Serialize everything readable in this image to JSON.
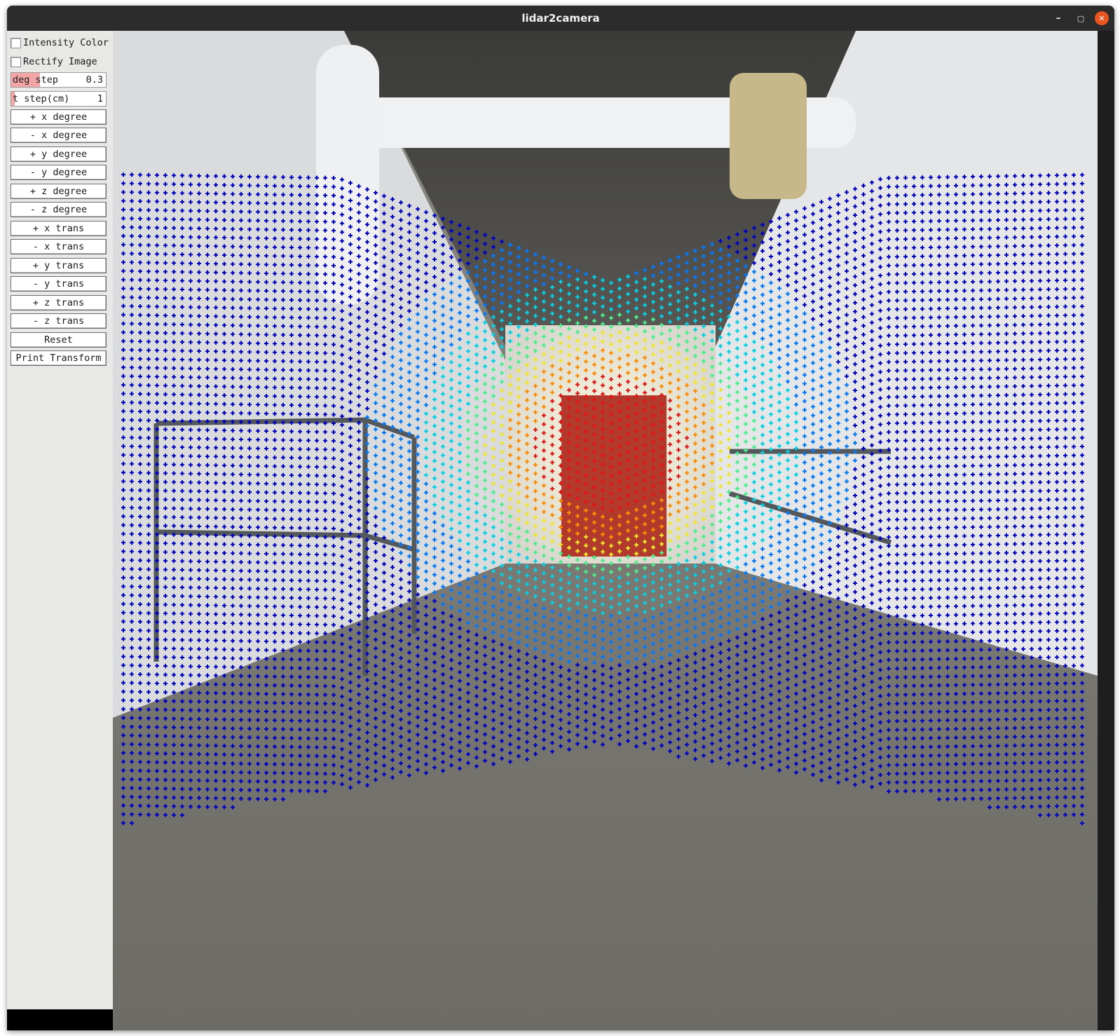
{
  "window": {
    "title": "lidar2camera",
    "minimize_icon": "minimize-icon",
    "maximize_icon": "maximize-icon",
    "close_icon": "close-icon",
    "close_color": "#e95420"
  },
  "controls": {
    "intensity_color": {
      "label": "Intensity Color",
      "checked": false
    },
    "rectify_image": {
      "label": "Rectify Image",
      "checked": false
    },
    "deg_step": {
      "label": "deg step",
      "value": "0.3",
      "slider_fraction": 0.3
    },
    "t_step": {
      "label": "t step(cm)",
      "value": "1",
      "slider_fraction": 0.04
    },
    "buttons": [
      "+ x degree",
      "- x degree",
      "+ y degree",
      "- y degree",
      "+ z degree",
      "- z degree",
      "+ x trans",
      "- x trans",
      "+ y trans",
      "- y trans",
      "+ z trans",
      "- z trans",
      "Reset",
      "Print Transform"
    ]
  },
  "scene": {
    "description_free": true,
    "point_colormap": [
      "#0000c8",
      "#0078ff",
      "#00d2e6",
      "#46f08c",
      "#f0e628",
      "#ff8c00",
      "#e61414"
    ],
    "highlight_color": "#f4a5a5"
  }
}
